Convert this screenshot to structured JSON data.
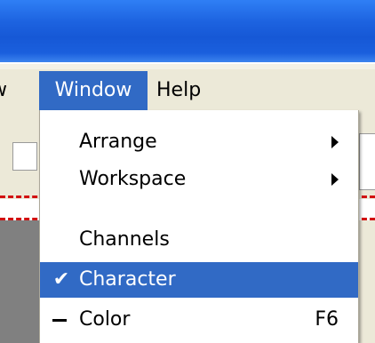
{
  "menubar": {
    "partial_item": "w",
    "items": [
      {
        "label": "Window",
        "active": true
      },
      {
        "label": "Help",
        "active": false
      }
    ]
  },
  "window_menu": {
    "items": [
      {
        "label": "Arrange",
        "submenu": true
      },
      {
        "label": "Workspace",
        "submenu": true
      },
      {
        "label": "Channels"
      },
      {
        "label": "Character",
        "checked": true,
        "highlighted": true
      },
      {
        "label": "Color",
        "shortcut": "F6",
        "indicator": "dash"
      }
    ]
  },
  "colors": {
    "titlebar": "#1658d6",
    "highlight": "#316ac5",
    "menubar": "#ece9d8",
    "dashed_line": "#d21010"
  }
}
